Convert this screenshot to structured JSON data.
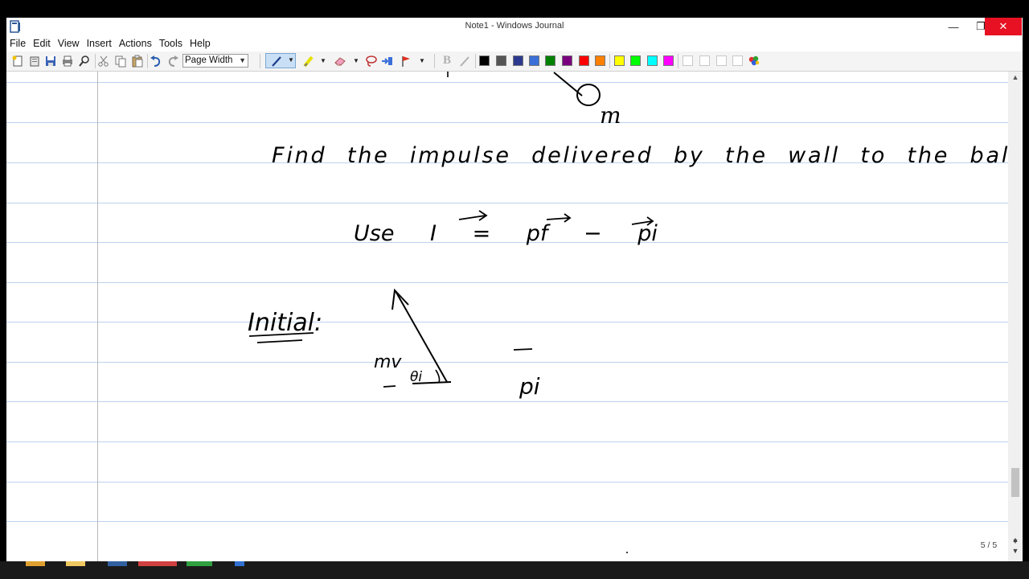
{
  "window": {
    "title": "Note1 - Windows Journal"
  },
  "window_controls": {
    "minimize": "—",
    "restore": "❐",
    "close": "✕"
  },
  "menu": [
    "File",
    "Edit",
    "View",
    "Insert",
    "Actions",
    "Tools",
    "Help"
  ],
  "toolbar": {
    "zoom_value": "Page Width",
    "bold_label": "B",
    "pen_colors": [
      "#000000",
      "#555555",
      "#2b3a8f",
      "#3a6fd8",
      "#008000",
      "#7a0080",
      "#ff0000",
      "#ff8000",
      "#ffff00",
      "#00ff00",
      "#00ffff",
      "#ff00ff"
    ]
  },
  "note": {
    "handwriting": {
      "line1": "m",
      "line2": "Find the impulse delivered by the wall to the ball.",
      "line3": "Use I = pf − pi",
      "line4_label": "Initial:",
      "diagram_labels": [
        "mv",
        "θi",
        "pi"
      ]
    }
  },
  "status": {
    "page_indicator": "5 / 5"
  }
}
